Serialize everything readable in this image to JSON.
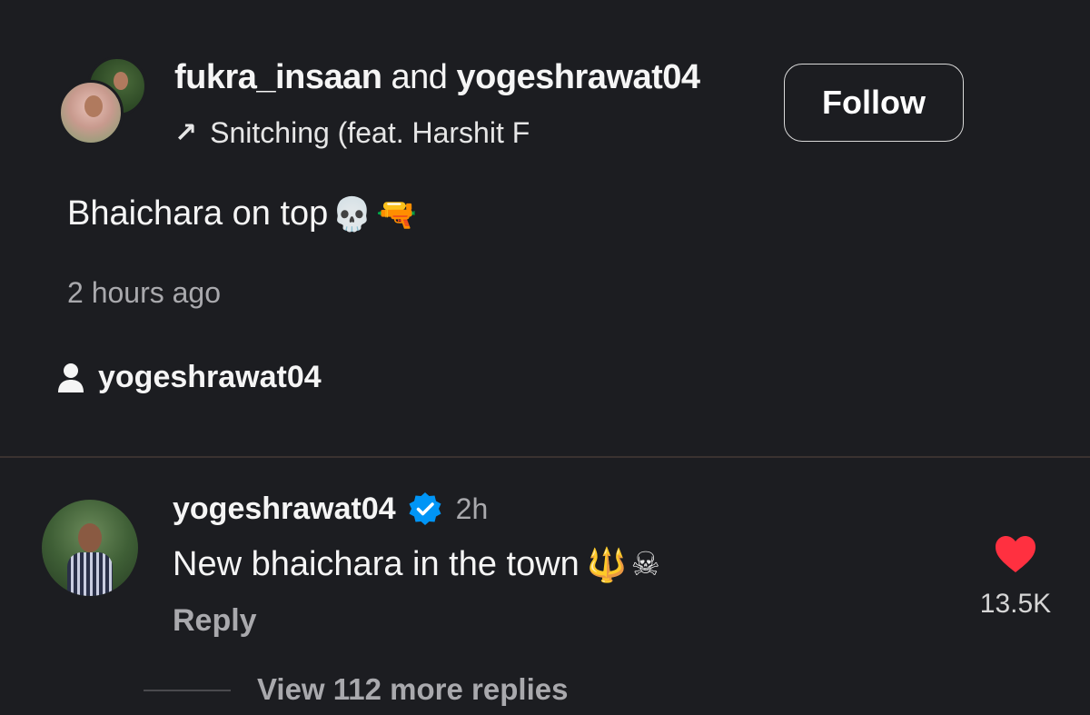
{
  "post": {
    "author1": "fukra_insaan",
    "and_text": "and",
    "author2": "yogeshrawat04",
    "audio_arrow": "↗",
    "audio_title": "Snitching (feat. Harshit F",
    "follow_label": "Follow",
    "caption": "Bhaichara on top",
    "caption_emojis": [
      "skull",
      "water-pistol"
    ],
    "time_ago": "2 hours ago",
    "tagged_user": "yogeshrawat04"
  },
  "comment": {
    "username": "yogeshrawat04",
    "verified": true,
    "time": "2h",
    "text": "New bhaichara in the town",
    "text_emojis": [
      "trident",
      "skull-and-crossbones"
    ],
    "reply_label": "Reply",
    "likes": "13.5K",
    "view_more": "View 112 more replies"
  },
  "colors": {
    "background": "#1c1d21",
    "heart": "#ff3040",
    "verified": "#0095f6",
    "muted_text": "#a9a9ad"
  },
  "icons": {
    "audio": "arrow-up-right-icon",
    "tag": "person-icon",
    "verified": "verified-badge-icon",
    "like": "heart-icon"
  }
}
